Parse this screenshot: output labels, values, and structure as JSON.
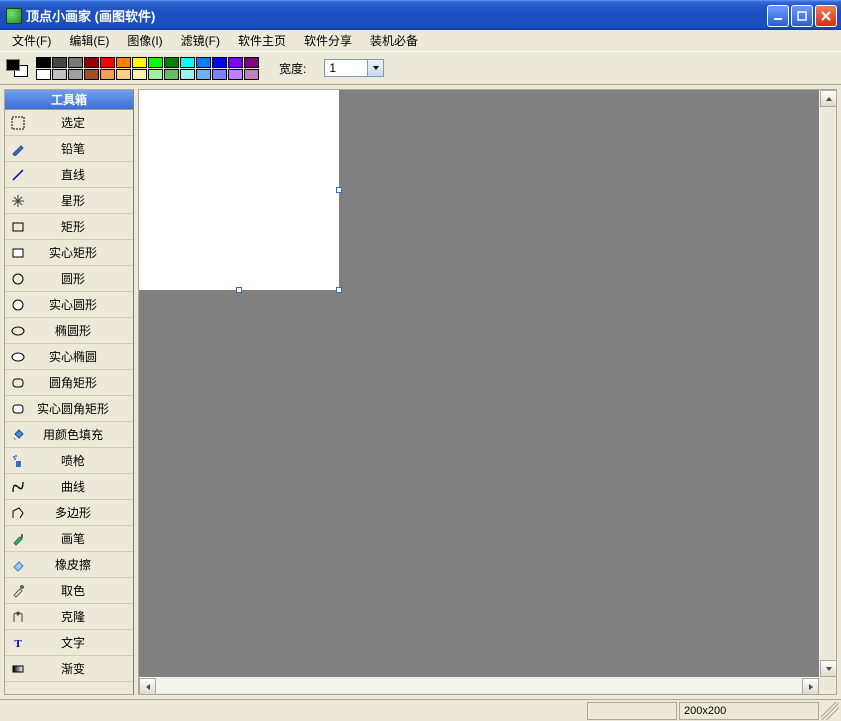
{
  "window": {
    "title": "顶点小画家 (画图软件)"
  },
  "menu": {
    "file": "文件(F)",
    "edit": "编辑(E)",
    "image": "图像(I)",
    "filter": "滤镜(F)",
    "home": "软件主页",
    "share": "软件分享",
    "required": "装机必备"
  },
  "toolbar": {
    "width_label": "宽度:",
    "width_value": "1"
  },
  "palette": {
    "row1": [
      "#000000",
      "#464646",
      "#787878",
      "#990000",
      "#ff0000",
      "#ff7f00",
      "#ffff00",
      "#00ff00",
      "#008000",
      "#00ffff",
      "#0080ff",
      "#0000ff",
      "#8000ff",
      "#800080"
    ],
    "row2": [
      "#ffffff",
      "#c0c0c0",
      "#a0a0a0",
      "#a05020",
      "#f0a050",
      "#f8d080",
      "#f8f0b0",
      "#a0f0a0",
      "#60c060",
      "#a0f0f0",
      "#70b0f0",
      "#8080ff",
      "#c080ff",
      "#c080c0"
    ]
  },
  "toolbox": {
    "title": "工具箱",
    "tools": [
      {
        "name": "选定",
        "icon": "select-icon"
      },
      {
        "name": "铅笔",
        "icon": "pencil-icon"
      },
      {
        "name": "直线",
        "icon": "line-icon"
      },
      {
        "name": "星形",
        "icon": "star-icon"
      },
      {
        "name": "矩形",
        "icon": "rectangle-icon"
      },
      {
        "name": "实心矩形",
        "icon": "filled-rectangle-icon"
      },
      {
        "name": "圆形",
        "icon": "circle-icon"
      },
      {
        "name": "实心圆形",
        "icon": "filled-circle-icon"
      },
      {
        "name": "椭圆形",
        "icon": "ellipse-icon"
      },
      {
        "name": "实心椭圆",
        "icon": "filled-ellipse-icon"
      },
      {
        "name": "圆角矩形",
        "icon": "round-rect-icon"
      },
      {
        "name": "实心圆角矩形",
        "icon": "filled-round-rect-icon"
      },
      {
        "name": "用颜色填充",
        "icon": "fill-icon"
      },
      {
        "name": "喷枪",
        "icon": "spray-icon"
      },
      {
        "name": "曲线",
        "icon": "curve-icon"
      },
      {
        "name": "多边形",
        "icon": "polygon-icon"
      },
      {
        "name": "画笔",
        "icon": "brush-icon"
      },
      {
        "name": "橡皮擦",
        "icon": "eraser-icon"
      },
      {
        "name": "取色",
        "icon": "picker-icon"
      },
      {
        "name": "克隆",
        "icon": "clone-icon"
      },
      {
        "name": "文字",
        "icon": "text-icon"
      },
      {
        "name": "渐变",
        "icon": "gradient-icon"
      }
    ]
  },
  "canvas": {
    "dimensions": "200x200"
  }
}
